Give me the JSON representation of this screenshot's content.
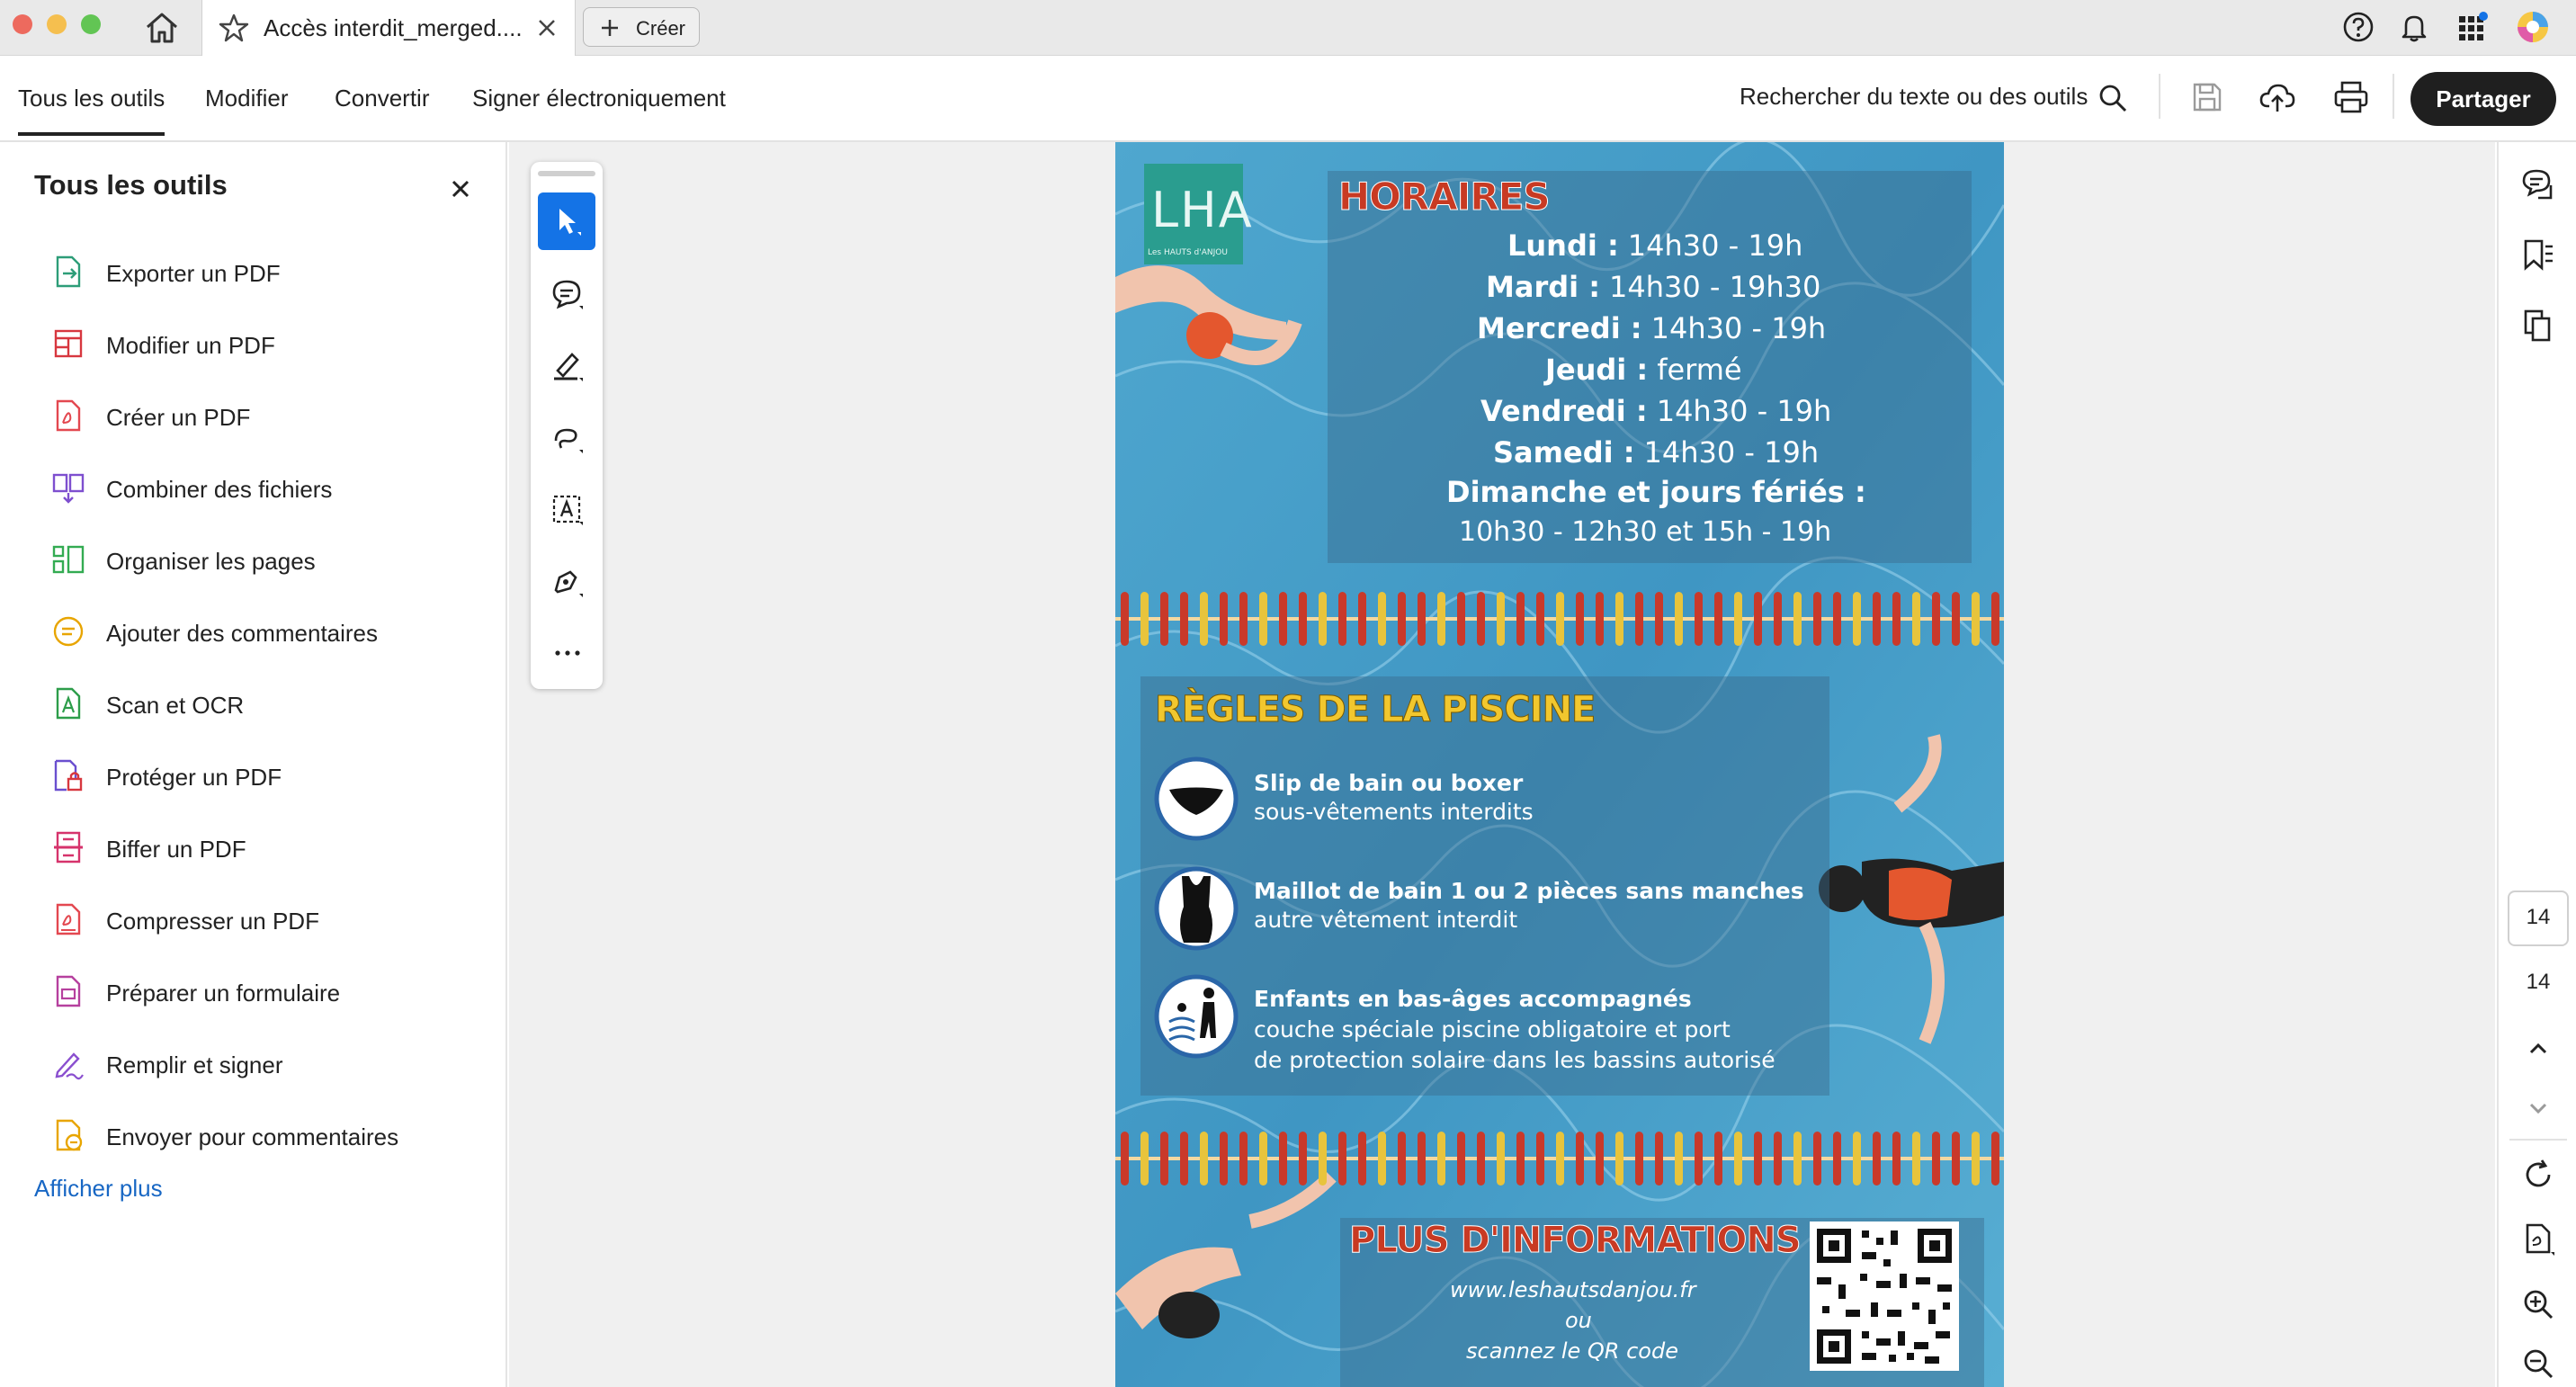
{
  "browser": {
    "tab_title": "Accès interdit_merged....",
    "new_label": "Créer"
  },
  "toolbar": {
    "menus": [
      "Tous les outils",
      "Modifier",
      "Convertir",
      "Signer électroniquement"
    ],
    "search_label": "Rechercher du texte ou des outils",
    "share_label": "Partager"
  },
  "panel": {
    "title": "Tous les outils",
    "tools": [
      {
        "label": "Exporter un PDF",
        "icon": "export-pdf-icon",
        "color": "#2d9d78"
      },
      {
        "label": "Modifier un PDF",
        "icon": "edit-pdf-icon",
        "color": "#d7373f"
      },
      {
        "label": "Créer un PDF",
        "icon": "create-pdf-icon",
        "color": "#e34850"
      },
      {
        "label": "Combiner des fichiers",
        "icon": "combine-files-icon",
        "color": "#7e4fcf"
      },
      {
        "label": "Organiser les pages",
        "icon": "organize-pages-icon",
        "color": "#33ab52"
      },
      {
        "label": "Ajouter des commentaires",
        "icon": "comment-icon",
        "color": "#e8a500"
      },
      {
        "label": "Scan et OCR",
        "icon": "scan-ocr-icon",
        "color": "#2d9d4a"
      },
      {
        "label": "Protéger un PDF",
        "icon": "protect-pdf-icon",
        "color": "#6a4fcf"
      },
      {
        "label": "Biffer un PDF",
        "icon": "redact-pdf-icon",
        "color": "#d6336c"
      },
      {
        "label": "Compresser un PDF",
        "icon": "compress-pdf-icon",
        "color": "#e34850"
      },
      {
        "label": "Préparer un formulaire",
        "icon": "prepare-form-icon",
        "color": "#b6409e"
      },
      {
        "label": "Remplir et signer",
        "icon": "fill-sign-icon",
        "color": "#8a4fcf"
      },
      {
        "label": "Envoyer pour commentaires",
        "icon": "send-comments-icon",
        "color": "#e8a500"
      }
    ],
    "more_label": "Afficher plus"
  },
  "pager": {
    "current": "14",
    "total": "14"
  },
  "document": {
    "logo_text": "LHA",
    "logo_sub": "Les HAUTS d'ANJOU",
    "hours_title": "HORAIRES",
    "hours": [
      {
        "day": "Lundi :",
        "time": "14h30 - 19h"
      },
      {
        "day": "Mardi :",
        "time": "14h30 - 19h30"
      },
      {
        "day": "Mercredi :",
        "time": "14h30 - 19h"
      },
      {
        "day": "Jeudi :",
        "time": "fermé"
      },
      {
        "day": "Vendredi :",
        "time": "14h30 - 19h"
      },
      {
        "day": "Samedi :",
        "time": "14h30 - 19h"
      }
    ],
    "sunday_label": "Dimanche et jours fériés :",
    "sunday_time": "10h30 - 12h30 et 15h - 19h",
    "rules_title": "RÈGLES DE LA PISCINE",
    "rules": [
      {
        "bold": "Slip de bain ou boxer",
        "line1": "sous-vêtements interdits",
        "line2": ""
      },
      {
        "bold": "Maillot de bain 1 ou 2 pièces sans manches",
        "line1": "autre vêtement interdit",
        "line2": ""
      },
      {
        "bold": "Enfants en bas-âges accompagnés",
        "line1": "couche spéciale piscine obligatoire et port",
        "line2": "de protection solaire dans les bassins autorisé"
      }
    ],
    "info_title": "PLUS D'INFORMATIONS",
    "info_url": "www.leshautsdanjou.fr",
    "info_or": "ou",
    "info_qr": "scannez le QR code"
  }
}
